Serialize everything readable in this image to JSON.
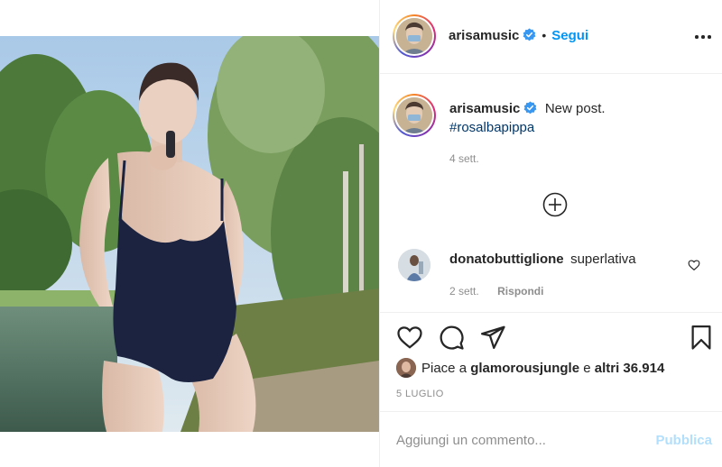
{
  "post": {
    "author": "arisamusic",
    "follow_label": "Segui",
    "separator": "•"
  },
  "caption": {
    "author": "arisamusic",
    "text": "New post.",
    "hashtag": "#rosalbapippa",
    "time": "4 sett."
  },
  "comments": [
    {
      "author": "donatobuttiglione",
      "text": "superlativa",
      "time": "2 sett.",
      "reply_label": "Rispondi"
    }
  ],
  "likes": {
    "prefix": "Piace a",
    "user": "glamorousjungle",
    "conjunction": "e",
    "others": "altri 36.914"
  },
  "date": "5 LUGLIO",
  "comment_input": {
    "placeholder": "Aggiungi un commento...",
    "submit_label": "Pubblica"
  },
  "icons": {
    "verified": "verified-badge-icon",
    "more": "more-options-icon",
    "load_more": "plus-circle-icon",
    "like": "heart-icon",
    "comment": "comment-bubble-icon",
    "share": "paper-plane-icon",
    "save": "bookmark-icon"
  },
  "colors": {
    "accent": "#0095f6",
    "hashtag": "#00376b",
    "muted": "#8e8e8e",
    "publish_disabled": "#b2dffc",
    "text": "#262626"
  }
}
